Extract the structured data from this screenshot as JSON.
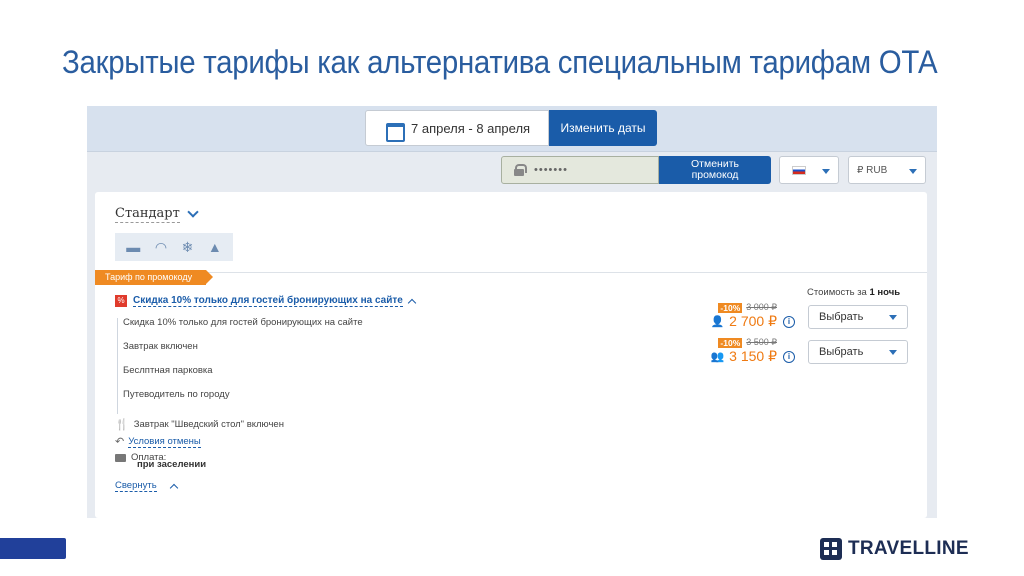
{
  "slide": {
    "title": "Закрытые тарифы как альтернатива специальным тарифам ОТА"
  },
  "dates": {
    "range": "7 апреля - 8 апреля",
    "change_label": "Изменить даты"
  },
  "promo": {
    "masked_code": "•••••••",
    "cancel_label": "Отменить промокод"
  },
  "locale": {
    "currency": "₽  RUB"
  },
  "room": {
    "title": "Стандарт",
    "amenity_icons": [
      "bed-icon",
      "wifi-icon",
      "snowflake-icon",
      "shower-icon"
    ]
  },
  "tariff": {
    "badge": "Тариф по промокоду",
    "percent_glyph": "%",
    "name": "Скидка 10% только для гостей бронирующих на сайте",
    "details": [
      "Скидка 10% только для гостей бронирующих на сайте",
      "Завтрак включен",
      "Беслптная парковка",
      "Путеводитель по городу"
    ],
    "breakfast": "Завтрак \"Шведский стол\" включен",
    "cancel_conditions": "Условия отмены",
    "payment_label": "Оплата:",
    "payment_value": "при заселении",
    "collapse": "Свернуть"
  },
  "cost": {
    "label_prefix": "Стоимость за ",
    "label_nights": "1 ночь"
  },
  "prices": [
    {
      "discount": "-10%",
      "old": "3 000 ₽",
      "new": "2 700 ₽",
      "guests": 1
    },
    {
      "discount": "-10%",
      "old": "3 500 ₽",
      "new": "3 150 ₽",
      "guests": 2
    }
  ],
  "select_label": "Выбрать",
  "brand": {
    "logo_text": "TRAVELLINE"
  },
  "colors": {
    "title_blue": "#2a5d9f",
    "primary_blue": "#1a5ca9",
    "accent_orange": "#ef8a22",
    "brand_navy": "#1d2d54"
  }
}
